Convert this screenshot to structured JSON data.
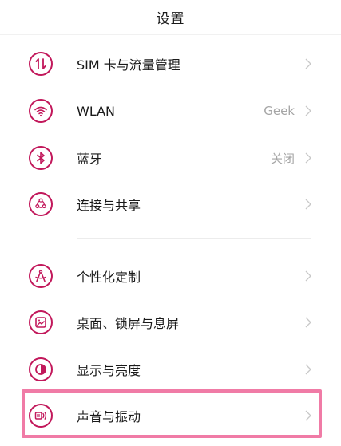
{
  "header": {
    "title": "设置"
  },
  "items": [
    {
      "label": "SIM 卡与流量管理",
      "value": "",
      "icon": "sim-data-icon"
    },
    {
      "label": "WLAN",
      "value": "Geek",
      "icon": "wifi-icon"
    },
    {
      "label": "蓝牙",
      "value": "关闭",
      "icon": "bluetooth-icon"
    },
    {
      "label": "连接与共享",
      "value": "",
      "icon": "share-connect-icon"
    },
    {
      "label": "个性化定制",
      "value": "",
      "icon": "personalize-icon"
    },
    {
      "label": "桌面、锁屏与息屏",
      "value": "",
      "icon": "wallpaper-icon"
    },
    {
      "label": "显示与亮度",
      "value": "",
      "icon": "brightness-icon"
    },
    {
      "label": "声音与振动",
      "value": "",
      "icon": "sound-vibration-icon"
    }
  ],
  "colors": {
    "accent": "#c2185b",
    "highlight": "#f07ba6",
    "secondary_text": "#a6a6a6"
  }
}
